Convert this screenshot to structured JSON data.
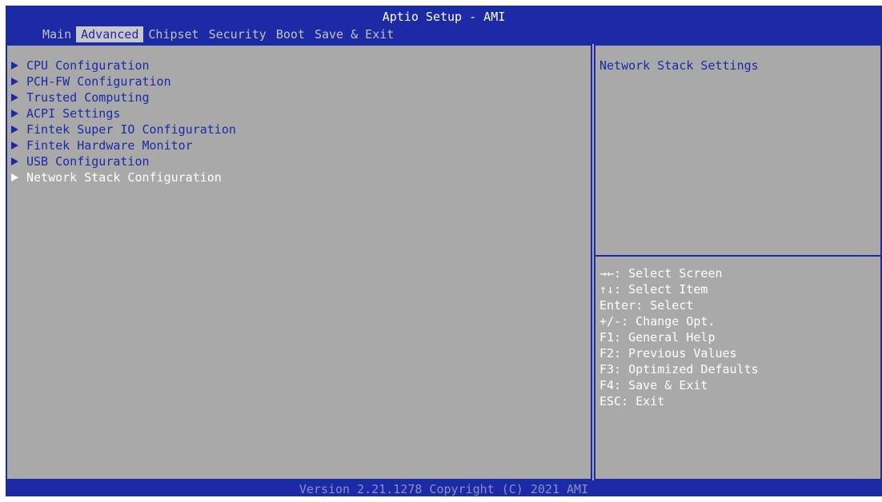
{
  "header": {
    "title": "Aptio Setup - AMI",
    "tabs": [
      "Main",
      "Advanced",
      "Chipset",
      "Security",
      "Boot",
      "Save & Exit"
    ],
    "active_tab": "Advanced"
  },
  "menu": {
    "items": [
      "CPU Configuration",
      "PCH-FW Configuration",
      "Trusted Computing",
      "ACPI Settings",
      "Fintek Super IO Configuration",
      "Fintek Hardware Monitor",
      "USB Configuration",
      "Network Stack Configuration"
    ],
    "selected_index": 7
  },
  "help": {
    "text": "Network Stack Settings"
  },
  "keys": [
    "→←: Select Screen",
    "↑↓: Select Item",
    "Enter: Select",
    "+/-: Change Opt.",
    "F1: General Help",
    "F2: Previous Values",
    "F3: Optimized Defaults",
    "F4: Save & Exit",
    "ESC: Exit"
  ],
  "footer": {
    "version": "Version 2.21.1278 Copyright (C) 2021 AMI"
  },
  "colors": {
    "bios_blue": "#1c2aa6",
    "panel_grey": "#a9a9a9",
    "tab_highlight": "#c8c8c8",
    "text_white": "#ffffff"
  }
}
